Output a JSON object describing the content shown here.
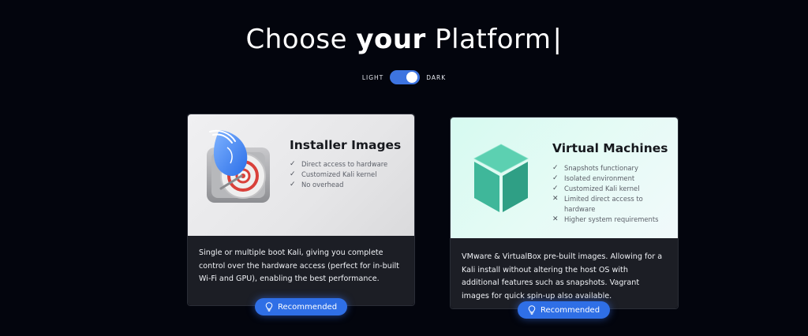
{
  "header": {
    "title_part1": "Choose",
    "title_bold": "your",
    "title_part2": "Platform",
    "title_caret": "|"
  },
  "theme_toggle": {
    "left_label": "LIGHT",
    "right_label": "DARK",
    "state": "dark"
  },
  "cards": [
    {
      "title": "Installer Images",
      "features": [
        {
          "icon": "check-icon",
          "mark": "✓",
          "text": "Direct access to hardware"
        },
        {
          "icon": "check-icon",
          "mark": "✓",
          "text": "Customized Kali kernel"
        },
        {
          "icon": "check-icon",
          "mark": "✓",
          "text": "No overhead"
        }
      ],
      "description": "Single or multiple boot Kali, giving you complete control over the hardware access (perfect for in-built Wi-Fi and GPU), enabling the best performance.",
      "badge": "Recommended"
    },
    {
      "title": "Virtual Machines",
      "features": [
        {
          "icon": "check-icon",
          "mark": "✓",
          "text": "Snapshots functionary"
        },
        {
          "icon": "check-icon",
          "mark": "✓",
          "text": "Isolated environment"
        },
        {
          "icon": "check-icon",
          "mark": "✓",
          "text": "Customized Kali kernel"
        },
        {
          "icon": "cross-icon",
          "mark": "✕",
          "text": "Limited direct access to hardware"
        },
        {
          "icon": "cross-icon",
          "mark": "✕",
          "text": "Higher system requirements"
        }
      ],
      "description": "VMware & VirtualBox pre-built images. Allowing for a Kali install without altering the host OS with additional features such as snapshots. Vagrant images for quick spin-up also available.",
      "badge": "Recommended"
    }
  ],
  "colors": {
    "background": "#03050d",
    "accent": "#2f6fe6",
    "card_dark": "#1c1e25",
    "vm_cube": "#3fb79a"
  }
}
